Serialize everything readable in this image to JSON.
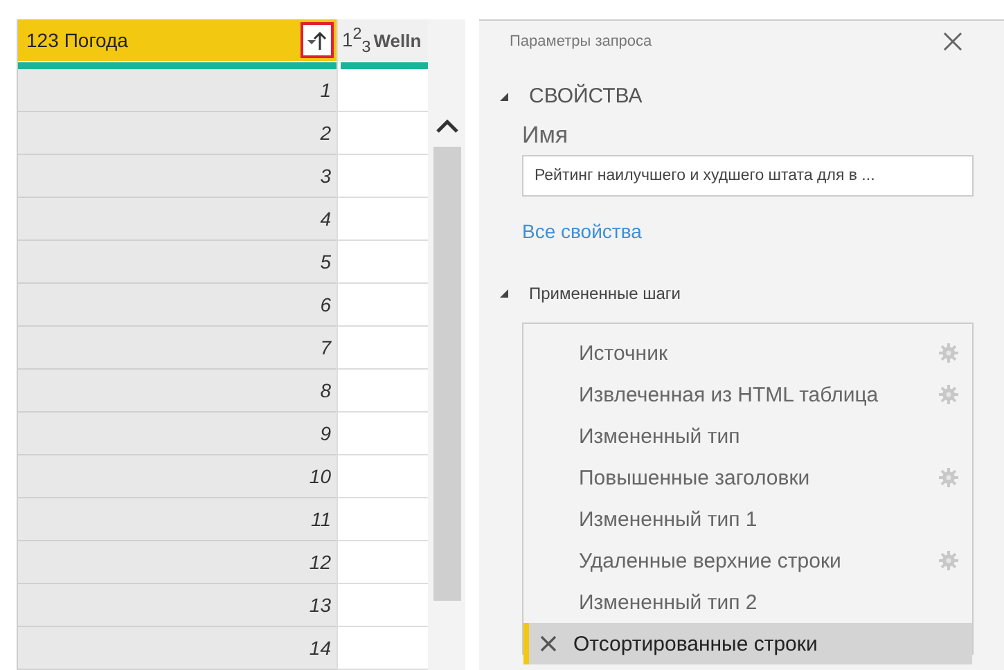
{
  "table": {
    "columns": [
      {
        "type_label": "123",
        "name": "Погода",
        "selected": true,
        "sort_button": true
      },
      {
        "type_label": "1$^{2}$$_{3}$",
        "name": "Welln",
        "selected": false,
        "sort_button": false
      }
    ],
    "rows": [
      {
        "cells": [
          "1",
          ""
        ]
      },
      {
        "cells": [
          "2",
          ""
        ]
      },
      {
        "cells": [
          "3",
          ""
        ]
      },
      {
        "cells": [
          "4",
          ""
        ]
      },
      {
        "cells": [
          "5",
          ""
        ]
      },
      {
        "cells": [
          "6",
          ""
        ]
      },
      {
        "cells": [
          "7",
          ""
        ]
      },
      {
        "cells": [
          "8",
          ""
        ]
      },
      {
        "cells": [
          "9",
          ""
        ]
      },
      {
        "cells": [
          "10",
          ""
        ]
      },
      {
        "cells": [
          "11",
          ""
        ]
      },
      {
        "cells": [
          "12",
          ""
        ]
      },
      {
        "cells": [
          "13",
          ""
        ]
      },
      {
        "cells": [
          "14",
          ""
        ]
      }
    ]
  },
  "query_settings": {
    "title": "Параметры запроса",
    "properties": {
      "heading": "СВОЙСТВА",
      "expanded": true,
      "name_label": "Имя",
      "name_value": "Рейтинг наилучшего и худшего штата для в ...",
      "all_properties_link": "Все свойства"
    },
    "applied_steps": {
      "heading": "Примененные шаги",
      "expanded": true,
      "steps": [
        {
          "label": "Источник",
          "has_settings": true,
          "selected": false
        },
        {
          "label": "Извлеченная из HTML таблица",
          "has_settings": true,
          "selected": false
        },
        {
          "label": "Измененный тип",
          "has_settings": false,
          "selected": false
        },
        {
          "label": "Повышенные заголовки",
          "has_settings": true,
          "selected": false
        },
        {
          "label": "Измененный тип 1",
          "has_settings": false,
          "selected": false
        },
        {
          "label": "Удаленные верхние строки",
          "has_settings": true,
          "selected": false
        },
        {
          "label": "Измененный тип 2",
          "has_settings": false,
          "selected": false
        },
        {
          "label": "Отсортированные строки",
          "has_settings": false,
          "selected": true
        }
      ]
    }
  }
}
